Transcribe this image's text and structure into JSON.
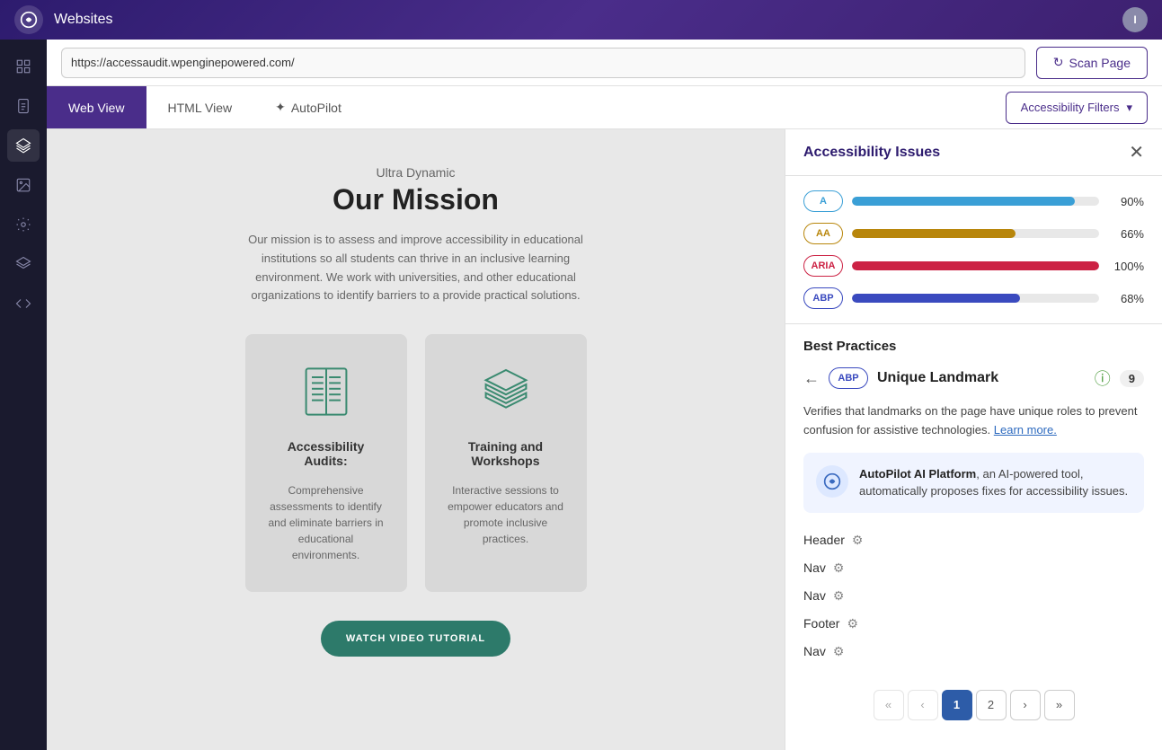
{
  "topBar": {
    "title": "Websites",
    "avatarLabel": "I"
  },
  "urlBar": {
    "url": "https://accessaudit.wpenginepowered.com/",
    "scanLabel": "Scan Page"
  },
  "viewTabs": [
    {
      "id": "web",
      "label": "Web View",
      "active": true
    },
    {
      "id": "html",
      "label": "HTML View",
      "active": false
    },
    {
      "id": "autopilot",
      "label": "AutoPilot",
      "active": false
    }
  ],
  "accessibilityFilter": {
    "label": "Accessibility Filters"
  },
  "webContent": {
    "subtitle": "Ultra Dynamic",
    "title": "Our Mission",
    "description": "Our mission is to assess and improve accessibility in educational institutions so all students can thrive in an inclusive learning environment. We work with universities, and other educational organizations to identify barriers to a provide practical solutions.",
    "cards": [
      {
        "title": "Accessibility Audits:",
        "description": "Comprehensive assessments to identify and eliminate barriers in educational environments.",
        "icon": "book"
      },
      {
        "title": "Training and Workshops",
        "description": "Interactive sessions to empower educators and promote inclusive practices.",
        "icon": "layers"
      }
    ],
    "watchButtonLabel": "WATCH VIDEO TUTORIAL"
  },
  "rightPanel": {
    "title": "Accessibility Issues",
    "issues": [
      {
        "badge": "A",
        "pct": 90,
        "pctLabel": "90%",
        "badgeClass": "badge-a",
        "fillClass": "progress-fill-a"
      },
      {
        "badge": "AA",
        "pct": 66,
        "pctLabel": "66%",
        "badgeClass": "badge-aa",
        "fillClass": "progress-fill-aa"
      },
      {
        "badge": "ARIA",
        "pct": 100,
        "pctLabel": "100%",
        "badgeClass": "badge-aria",
        "fillClass": "progress-fill-aria"
      },
      {
        "badge": "ABP",
        "pct": 68,
        "pctLabel": "68%",
        "badgeClass": "badge-abp",
        "fillClass": "progress-fill-abp"
      }
    ],
    "detail": {
      "sectionTitle": "Best Practices",
      "badgeLabel": "ABP",
      "landmarkTitle": "Unique Landmark",
      "count": 9,
      "description": "Verifies that landmarks on the page have unique roles to prevent confusion for assistive technologies.",
      "learnMoreLabel": "Learn more.",
      "autopilot": {
        "textBold": "AutoPilot AI Platform",
        "textRest": ", an AI-powered tool, automatically proposes fixes for accessibility issues."
      },
      "landmarks": [
        {
          "name": "Header"
        },
        {
          "name": "Nav"
        },
        {
          "name": "Nav"
        },
        {
          "name": "Footer"
        },
        {
          "name": "Nav"
        }
      ],
      "pagination": {
        "first": "«",
        "prev": "‹",
        "pages": [
          "1",
          "2"
        ],
        "next": "›",
        "last": "»",
        "currentPage": "1"
      }
    }
  },
  "sidebar": {
    "icons": [
      {
        "id": "grid",
        "label": "Grid"
      },
      {
        "id": "document",
        "label": "Document"
      },
      {
        "id": "layers",
        "label": "Layers"
      },
      {
        "id": "image",
        "label": "Image"
      },
      {
        "id": "settings",
        "label": "Settings"
      },
      {
        "id": "stack",
        "label": "Stack"
      },
      {
        "id": "code",
        "label": "Code"
      }
    ]
  }
}
